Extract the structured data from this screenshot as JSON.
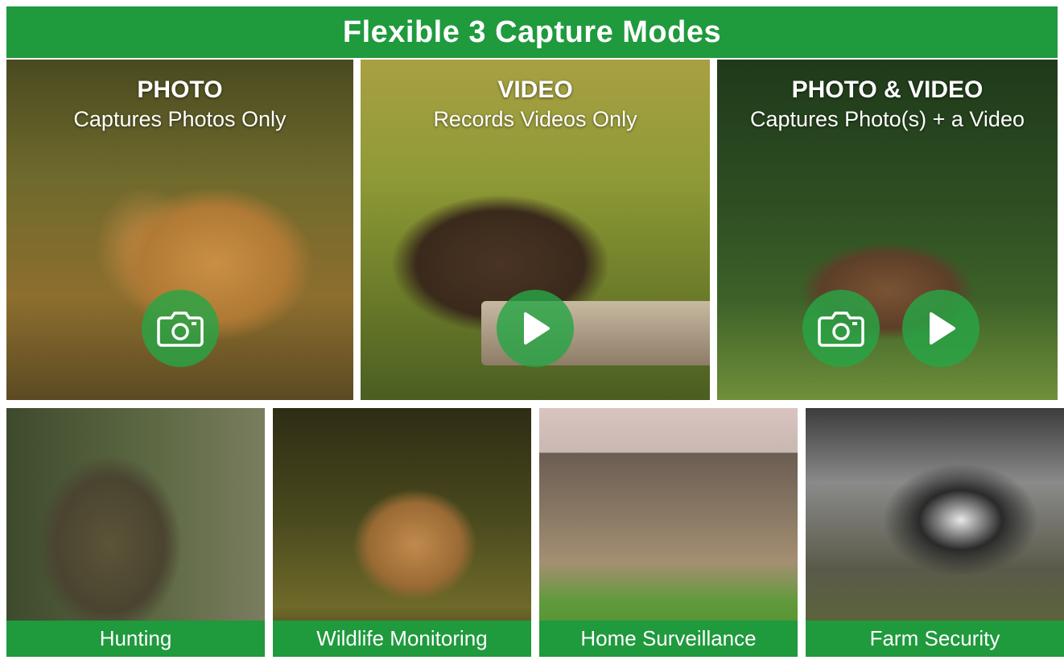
{
  "banner": {
    "title": "Flexible 3 Capture Modes"
  },
  "modes": [
    {
      "title": "PHOTO",
      "subtitle": "Captures Photos Only",
      "icons": [
        "camera-icon"
      ]
    },
    {
      "title": "VIDEO",
      "subtitle": "Records Videos Only",
      "icons": [
        "play-icon"
      ]
    },
    {
      "title": "PHOTO & VIDEO",
      "subtitle": "Captures Photo(s) + a Video",
      "icons": [
        "camera-icon",
        "play-icon"
      ]
    }
  ],
  "use_cases": [
    {
      "label": "Hunting"
    },
    {
      "label": "Wildlife Monitoring"
    },
    {
      "label": "Home Surveillance"
    },
    {
      "label": "Farm Security"
    }
  ],
  "colors": {
    "brand_green": "#1f9a3d",
    "icon_circle": "#28a546"
  }
}
